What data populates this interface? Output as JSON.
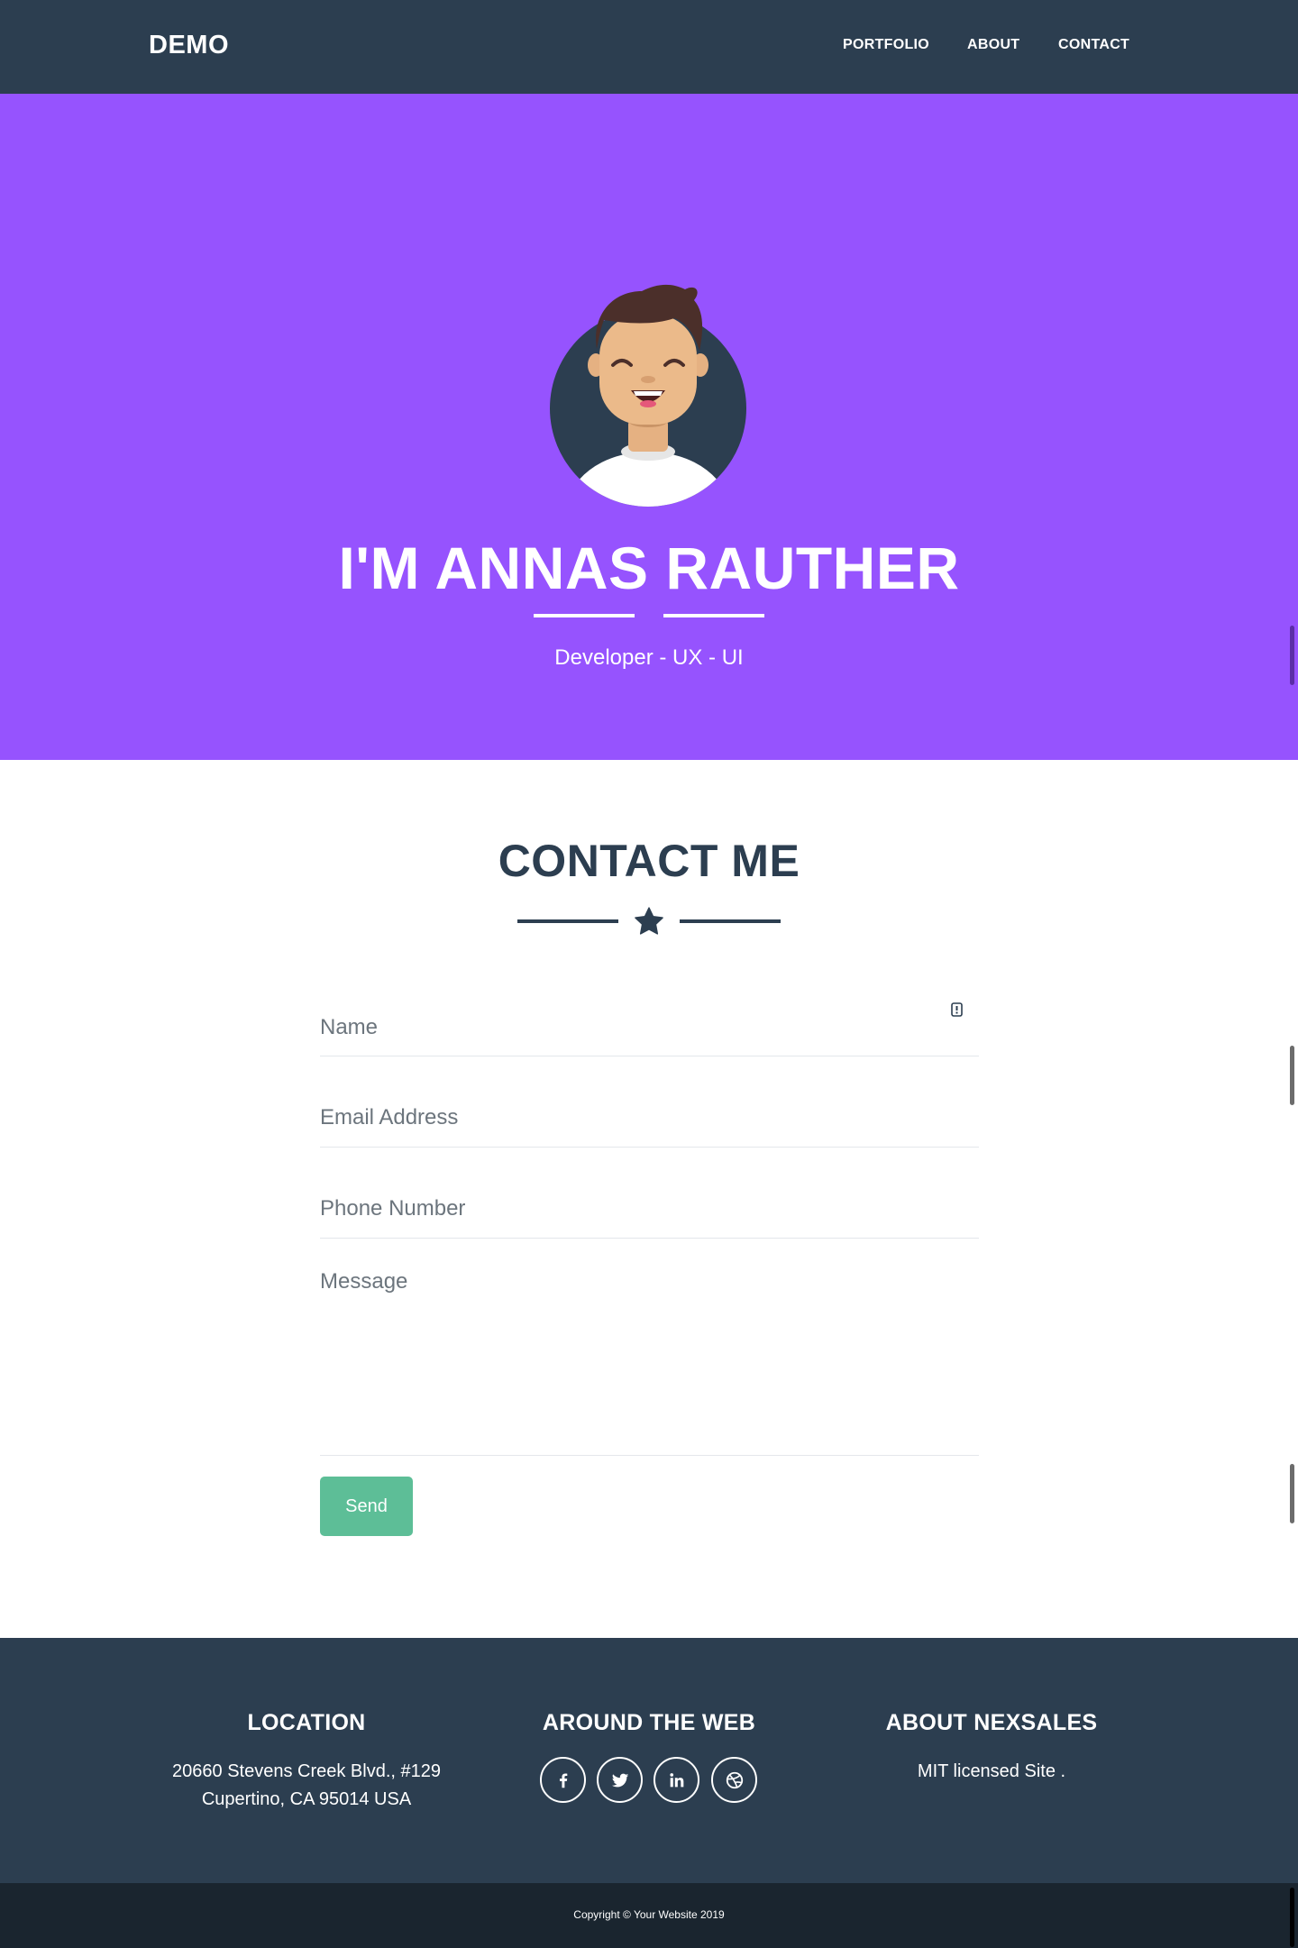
{
  "nav": {
    "brand": "DEMO",
    "links": [
      "PORTFOLIO",
      "ABOUT",
      "CONTACT"
    ]
  },
  "hero": {
    "avatar_icon": "avatar-illustration-icon",
    "title": "I'M ANNAS RAUTHER",
    "subtitle": "Developer - UX - UI"
  },
  "contact": {
    "title": "CONTACT ME",
    "divider_icon": "star-icon",
    "fields": {
      "name_placeholder": "Name",
      "email_placeholder": "Email Address",
      "phone_placeholder": "Phone Number",
      "message_placeholder": "Message"
    },
    "send_label": "Send"
  },
  "footer": {
    "location": {
      "heading": "LOCATION",
      "line1": "20660 Stevens Creek Blvd., #129",
      "line2": "Cupertino, CA 95014 USA"
    },
    "web": {
      "heading": "AROUND THE WEB",
      "icons": [
        "facebook-icon",
        "twitter-icon",
        "linkedin-icon",
        "dribbble-icon"
      ]
    },
    "about": {
      "heading": "ABOUT NEXSALES",
      "text": "MIT licensed Site ."
    },
    "copyright": "Copyright © Your Website 2019"
  },
  "colors": {
    "navbar": "#2c3e50",
    "hero": "#9653fe",
    "send_button": "#5dbe97",
    "copyright_bar": "#1a252f"
  }
}
